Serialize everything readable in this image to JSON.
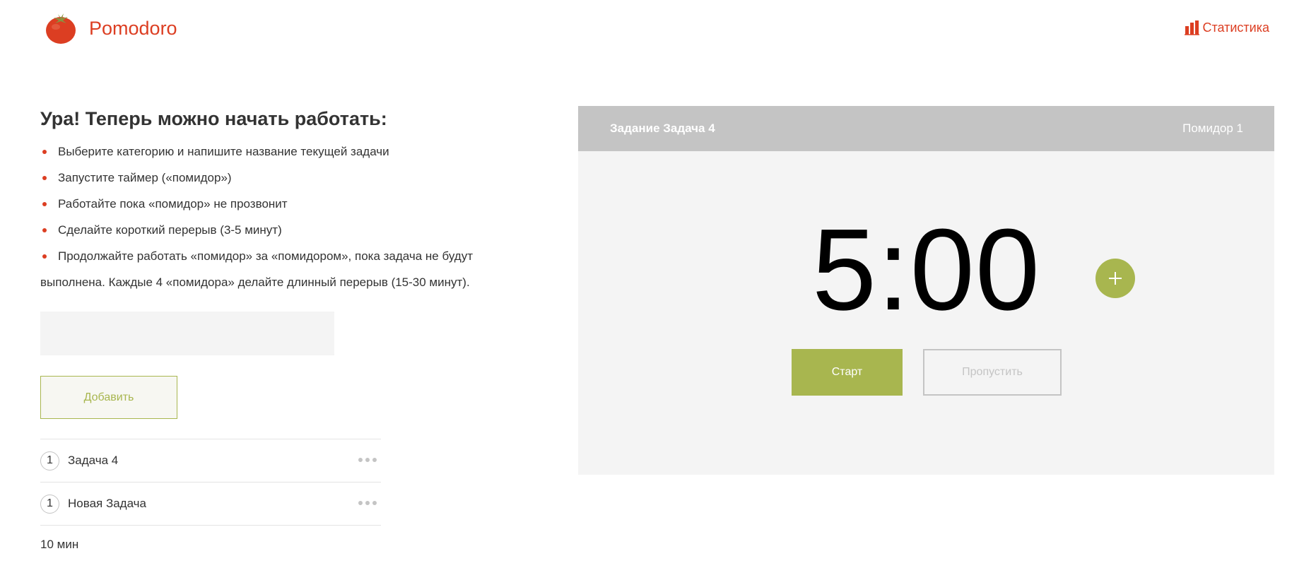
{
  "header": {
    "app_name": "Pomodoro",
    "logo_icon": "tomato-icon",
    "stats_label": "Статистика",
    "stats_icon": "bar-chart-icon"
  },
  "intro": {
    "title": "Ура! Теперь можно начать работать:",
    "steps": [
      "Выберите категорию и напишите название текущей задачи",
      "Запустите таймер («помидор»)",
      "Работайте пока «помидор» не прозвонит",
      "Сделайте короткий перерыв (3-5 минут)",
      "Продолжайте работать «помидор» за «помидором», пока задача не будут выполнена. Каждые 4 «помидора» делайте длинный перерыв (15-30 минут)."
    ]
  },
  "task_form": {
    "input_value": "",
    "add_label": "Добавить"
  },
  "tasks": [
    {
      "count": "1",
      "name": "Задача 4"
    },
    {
      "count": "1",
      "name": "Новая Задача"
    }
  ],
  "total_time": "10 мин",
  "timer": {
    "task_label": "Задание Задача 4",
    "pomodoro_label": "Помидор 1",
    "time": "5:00",
    "start_label": "Старт",
    "skip_label": "Пропустить"
  },
  "colors": {
    "brand": "#dc3e22",
    "accent_green": "#a8b64f",
    "panel_gray": "#c4c4c4",
    "panel_bg": "#f4f4f4"
  }
}
